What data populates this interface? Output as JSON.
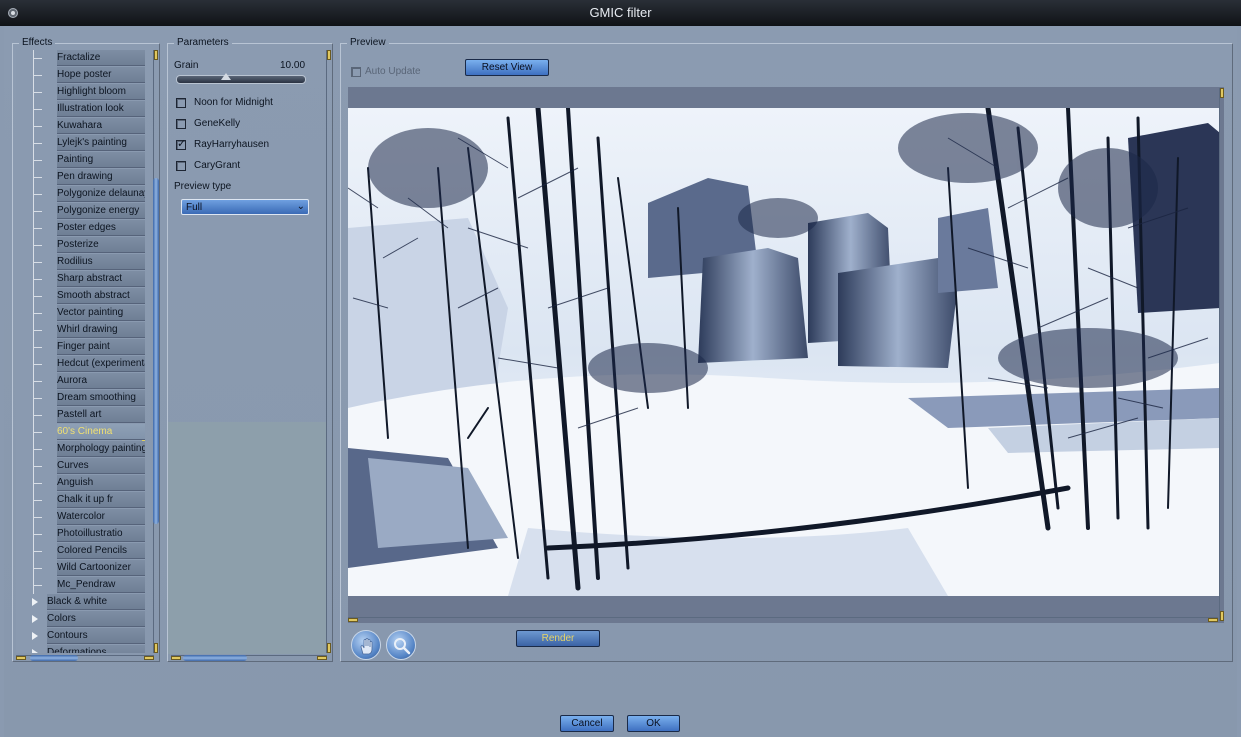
{
  "window": {
    "title": "GMIC filter"
  },
  "effects": {
    "label": "Effects",
    "items": [
      {
        "label": "Fractalize"
      },
      {
        "label": "Hope poster"
      },
      {
        "label": "Highlight bloom"
      },
      {
        "label": "Illustration look"
      },
      {
        "label": "Kuwahara"
      },
      {
        "label": "Lylejk's painting"
      },
      {
        "label": "Painting"
      },
      {
        "label": "Pen drawing"
      },
      {
        "label": "Polygonize delaunay"
      },
      {
        "label": "Polygonize energy"
      },
      {
        "label": "Poster edges"
      },
      {
        "label": "Posterize"
      },
      {
        "label": "Rodilius"
      },
      {
        "label": "Sharp abstract"
      },
      {
        "label": "Smooth abstract"
      },
      {
        "label": "Vector painting"
      },
      {
        "label": "Whirl drawing"
      },
      {
        "label": "Finger paint"
      },
      {
        "label": "Hedcut (experimenta"
      },
      {
        "label": "Aurora"
      },
      {
        "label": "Dream smoothing"
      },
      {
        "label": "Pastell art"
      },
      {
        "label": "60's Cinema",
        "selected": true
      },
      {
        "label": "Morphology painting"
      },
      {
        "label": "Curves"
      },
      {
        "label": "Anguish"
      },
      {
        "label": "Chalk it up fr"
      },
      {
        "label": "Watercolor"
      },
      {
        "label": "Photoillustratio"
      },
      {
        "label": "Colored Pencils"
      },
      {
        "label": "Wild Cartoonizer"
      },
      {
        "label": "Mc_Pendraw"
      }
    ],
    "categories": [
      {
        "label": "Black & white"
      },
      {
        "label": "Colors"
      },
      {
        "label": "Contours"
      },
      {
        "label": "Deformations"
      }
    ]
  },
  "parameters": {
    "label": "Parameters",
    "grain": {
      "label": "Grain",
      "value": "10.00",
      "position": 0.38
    },
    "checkboxes": [
      {
        "label": "Noon for Midnight",
        "checked": false
      },
      {
        "label": "GeneKelly",
        "checked": false
      },
      {
        "label": "RayHarryhausen",
        "checked": true
      },
      {
        "label": "CaryGrant",
        "checked": false
      }
    ],
    "preview_type": {
      "label": "Preview type",
      "value": "Full"
    }
  },
  "preview": {
    "label": "Preview",
    "auto_update_label": "Auto Update",
    "reset_view_label": "Reset View",
    "render_label": "Render",
    "tools": [
      "hand-icon",
      "magnifier-icon"
    ]
  },
  "footer": {
    "cancel_label": "Cancel",
    "ok_label": "OK"
  },
  "colors": {
    "accent": "#4a7fcf",
    "selection_text": "#f0e070",
    "background": "#8b9bb1"
  }
}
